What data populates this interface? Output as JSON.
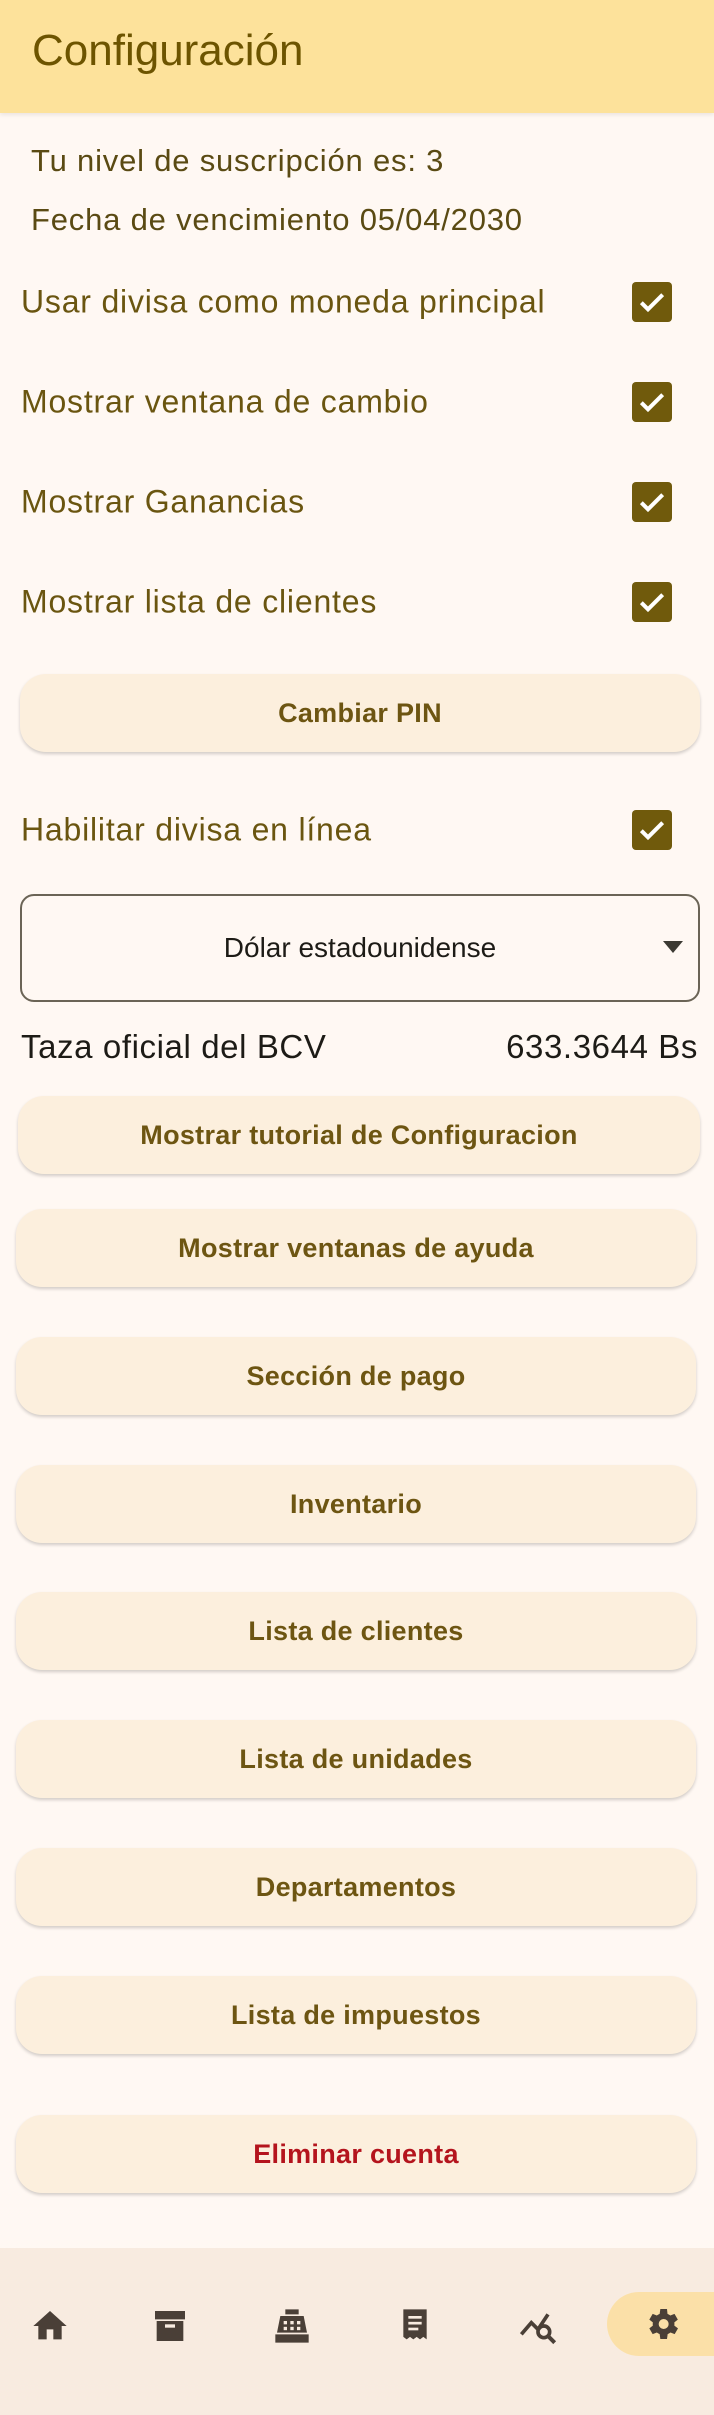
{
  "header": {
    "title": "Configuración"
  },
  "subscription": {
    "level": "Tu nivel de suscripción es: 3",
    "expiry": "Fecha de vencimiento 05/04/2030"
  },
  "options": [
    {
      "label": "Usar divisa como moneda principal",
      "checked": true
    },
    {
      "label": "Mostrar ventana de cambio",
      "checked": true
    },
    {
      "label": "Mostrar Ganancias",
      "checked": true
    },
    {
      "label": "Mostrar lista de clientes",
      "checked": true
    }
  ],
  "change_pin": "Cambiar PIN",
  "online_currency": {
    "label": "Habilitar divisa en línea",
    "checked": true
  },
  "currency_select": {
    "value": "Dólar estadounidense"
  },
  "rate": {
    "label": "Taza oficial del BCV",
    "value": "633.3644 Bs"
  },
  "buttons": {
    "tutorial": "Mostrar tutorial de Configuracion",
    "help": "Mostrar ventanas de ayuda",
    "payment": "Sección de pago",
    "inventory": "Inventario",
    "clients": "Lista de clientes",
    "units": "Lista de unidades",
    "departments": "Departamentos",
    "taxes": "Lista de impuestos",
    "delete": "Eliminar cuenta"
  },
  "colors": {
    "accent": "#705a0c",
    "danger": "#b4141d",
    "header": "#fde29b",
    "nav_active": "#fbe0a8"
  },
  "bottom_nav": {
    "icons": [
      "home-icon",
      "archive-icon",
      "cash-register-icon",
      "receipt-icon",
      "chart-search-icon",
      "settings-icon"
    ],
    "active": "settings-icon"
  }
}
